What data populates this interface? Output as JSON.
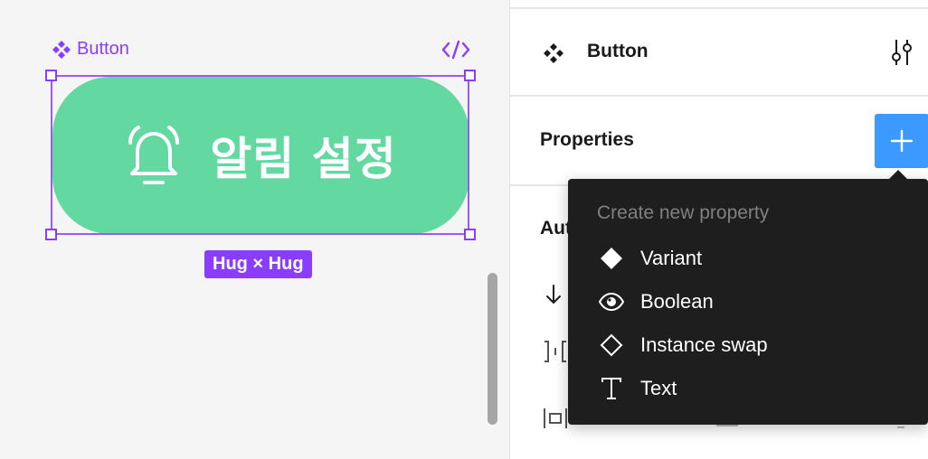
{
  "canvas": {
    "component_label": "Button",
    "button_text": "알림 설정",
    "size_badge": "Hug × Hug",
    "button_color": "#63d9a1",
    "selection_color": "#8b3dff",
    "icons": {
      "component": "component-diamond-icon",
      "code": "code-icon",
      "bell": "bell-icon"
    }
  },
  "panel": {
    "title": "Button",
    "properties_label": "Properties",
    "autolayout_label_partial": "Aut",
    "add_button_color": "#3b99ff",
    "icons": {
      "header": "component-icon",
      "tune": "tune-icon",
      "add": "plus-icon",
      "arrow": "arrow-down-icon"
    }
  },
  "dropdown": {
    "heading": "Create new property",
    "items": [
      {
        "label": "Variant",
        "icon": "filled-diamond-icon"
      },
      {
        "label": "Boolean",
        "icon": "eye-icon"
      },
      {
        "label": "Instance swap",
        "icon": "outline-diamond-icon"
      },
      {
        "label": "Text",
        "icon": "text-icon"
      }
    ]
  }
}
